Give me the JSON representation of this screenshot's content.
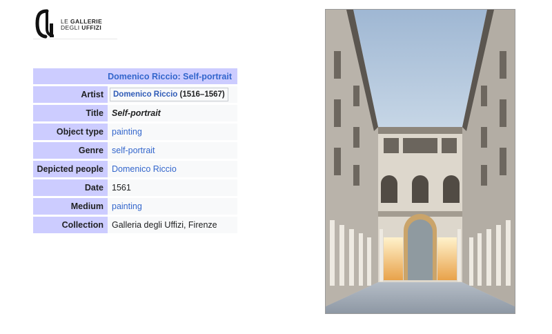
{
  "logo": {
    "line1_prefix": "LE ",
    "line1_bold": "GALLERIE",
    "line2_prefix": "DEGLI ",
    "line2_bold": "UFFIZI"
  },
  "infobox": {
    "title_artist": "Domenico Riccio",
    "title_separator": ": ",
    "title_work": "Self-portrait",
    "rows": {
      "artist": {
        "label": "Artist",
        "name": "Domenico Riccio",
        "years": " (1516–1567)"
      },
      "title": {
        "label": "Title",
        "value": "Self-portrait"
      },
      "object_type": {
        "label": "Object type",
        "value": "painting"
      },
      "genre": {
        "label": "Genre",
        "value": "self-portrait"
      },
      "depicted": {
        "label": "Depicted people",
        "value": "Domenico Riccio"
      },
      "date": {
        "label": "Date",
        "value": "1561"
      },
      "medium": {
        "label": "Medium",
        "value": "painting"
      },
      "collection": {
        "label": "Collection",
        "value": "Galleria degli Uffizi, Firenze"
      }
    }
  },
  "colors": {
    "header_bg": "#ccccff",
    "value_bg": "#f8f9fa",
    "link": "#3366cc"
  }
}
